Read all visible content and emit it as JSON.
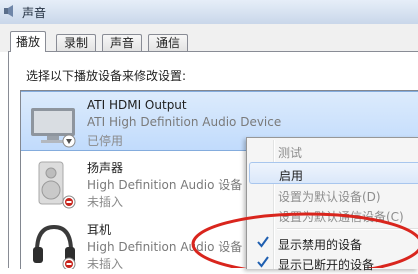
{
  "window": {
    "title": "声音"
  },
  "tabs": [
    {
      "label": "播放",
      "active": true
    },
    {
      "label": "录制"
    },
    {
      "label": "声音"
    },
    {
      "label": "通信"
    }
  ],
  "instruction": "选择以下播放设备来修改设置:",
  "devices": [
    {
      "name": "ATI HDMI Output",
      "description": "ATI High Definition Audio Device",
      "status": "已停用",
      "icon": "monitor-icon",
      "selected": true
    },
    {
      "name": "扬声器",
      "description": "High Definition Audio 设备",
      "status": "未插入",
      "icon": "speaker-icon"
    },
    {
      "name": "耳机",
      "description": "High Definition Audio 设备",
      "status": "未插入",
      "icon": "headphones-icon"
    }
  ],
  "context_menu": {
    "items": [
      {
        "label": "测试",
        "disabled": true
      },
      {
        "label": "启用",
        "hover": true
      },
      {
        "label": "设置为默认设备(D)",
        "disabled": true
      },
      {
        "label": "设置为默认通信设备(C)",
        "disabled": true
      },
      {
        "label": "显示禁用的设备",
        "checked": true
      },
      {
        "label": "显示已断开的设备",
        "checked": true
      }
    ]
  },
  "colors": {
    "annotation": "#d9251d",
    "selection": "#c9e0fc",
    "check": "#1f5fb0"
  }
}
